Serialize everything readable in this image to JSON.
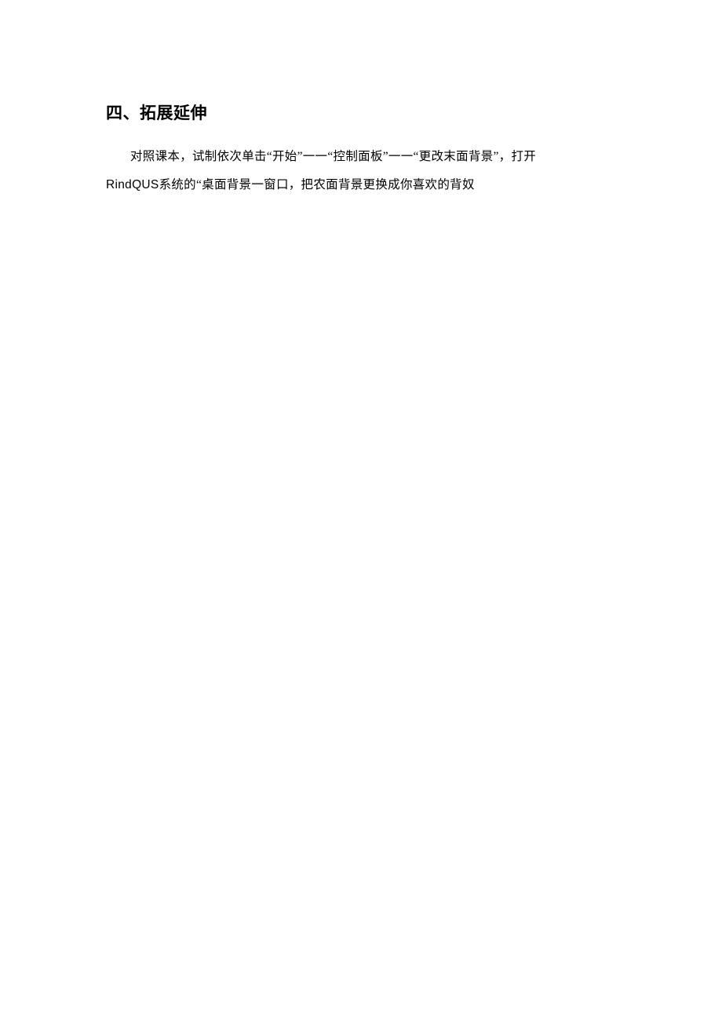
{
  "heading": "四、拓展延伸",
  "para1_part1": "对照课本，试制依次单击“开始”一一“控制面板”一一“更改末面背景”，打开",
  "para2_latin": "RindQUS",
  "para2_rest": "系统的“桌面背景一窗口，把农面背景更换成你喜欢的背奴"
}
